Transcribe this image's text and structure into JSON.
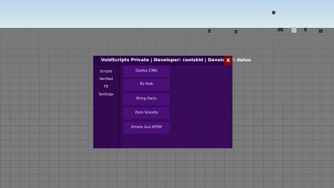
{
  "window": {
    "title": "VoidScripts Private | Developer: coolskid | Developer: deluu",
    "close_label": "X"
  },
  "sidebar": {
    "items": [
      {
        "label": "Scripts"
      },
      {
        "label": "Verified"
      },
      {
        "label": "FE"
      },
      {
        "label": "Settings"
      }
    ]
  },
  "scripts": {
    "buttons": [
      {
        "label": "Quirky CMD"
      },
      {
        "label": "Ez Hub"
      },
      {
        "label": "Bring Parts"
      },
      {
        "label": "Zero Gravity"
      },
      {
        "label": "Emote Gui AFEM"
      }
    ]
  },
  "colors": {
    "panel_bg": "#3a0a5b",
    "titlebar_bg": "#2a0547",
    "button_bg": "#4a0f78",
    "close_bg": "#7a0a0a"
  }
}
